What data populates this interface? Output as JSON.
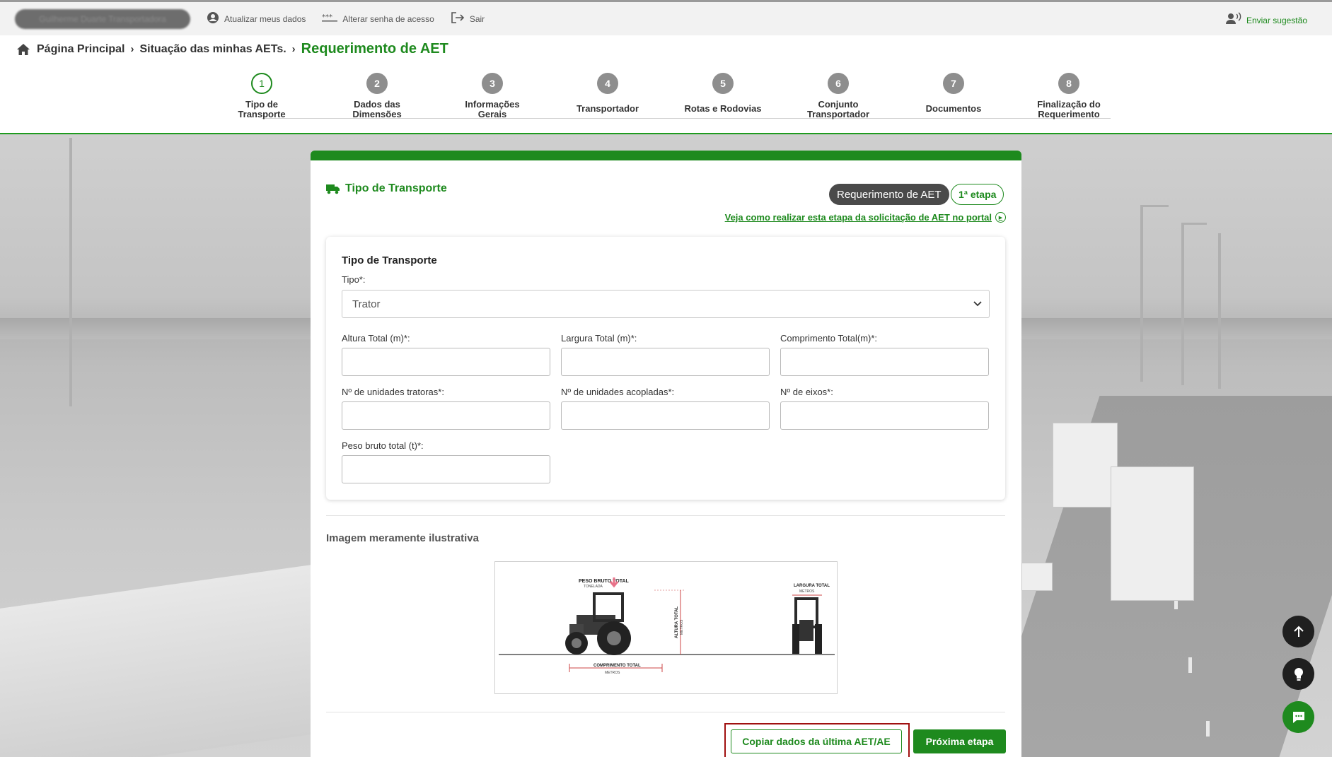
{
  "topbar": {
    "user_name": "Guilherme Duarte Transportadora",
    "links": [
      {
        "label": "Atualizar meus dados",
        "icon": "user-circle-icon"
      },
      {
        "label": "Alterar senha de acesso",
        "icon": "password-dots-icon"
      },
      {
        "label": "Sair",
        "icon": "logout-icon"
      }
    ],
    "suggest_label": "Enviar sugestão"
  },
  "breadcrumb": {
    "items": [
      "Página Principal",
      "Situação das minhas AETs."
    ],
    "current": "Requerimento de AET"
  },
  "stepper": {
    "active_index": 0,
    "steps": [
      {
        "number": "1",
        "label": "Tipo de Transporte"
      },
      {
        "number": "2",
        "label": "Dados das Dimensões"
      },
      {
        "number": "3",
        "label": "Informações Gerais"
      },
      {
        "number": "4",
        "label": "Transportador"
      },
      {
        "number": "5",
        "label": "Rotas e Rodovias"
      },
      {
        "number": "6",
        "label": "Conjunto Transportador"
      },
      {
        "number": "7",
        "label": "Documentos"
      },
      {
        "number": "8",
        "label": "Finalização do Requerimento"
      }
    ]
  },
  "card": {
    "title": "Tipo de Transporte",
    "badge_type": "Requerimento de AET",
    "badge_step": "1ª etapa",
    "help_link": "Veja como realizar esta etapa da solicitação de AET no portal"
  },
  "form": {
    "heading": "Tipo de Transporte",
    "tipo_label": "Tipo*:",
    "tipo_value": "Trator",
    "fields": [
      {
        "label": "Altura Total (m)*:",
        "value": ""
      },
      {
        "label": "Largura Total (m)*:",
        "value": ""
      },
      {
        "label": "Comprimento Total(m)*:",
        "value": ""
      },
      {
        "label": "Nº de unidades tratoras*:",
        "value": ""
      },
      {
        "label": "Nº de unidades acopladas*:",
        "value": ""
      },
      {
        "label": "Nº de eixos*:",
        "value": ""
      },
      {
        "label": "Peso bruto total (t)*:",
        "value": ""
      }
    ]
  },
  "illustration": {
    "title": "Imagem meramente ilustrativa",
    "labels": {
      "peso": "PESO BRUTO TOTAL",
      "peso_unit": "TONELADA",
      "altura": "ALTURA TOTAL",
      "altura_unit": "METROS",
      "largura": "LARGURA TOTAL",
      "largura_unit": "METROS",
      "comprimento": "COMPRIMENTO TOTAL",
      "comprimento_unit": "METROS"
    }
  },
  "actions": {
    "copy_label": "Copiar dados da última AET/AE",
    "next_label": "Próxima etapa"
  },
  "fabs": [
    "arrow-up-icon",
    "lightbulb-icon",
    "chat-icon"
  ],
  "colors": {
    "accent": "#1e8a1e",
    "highlight": "#a01010"
  }
}
